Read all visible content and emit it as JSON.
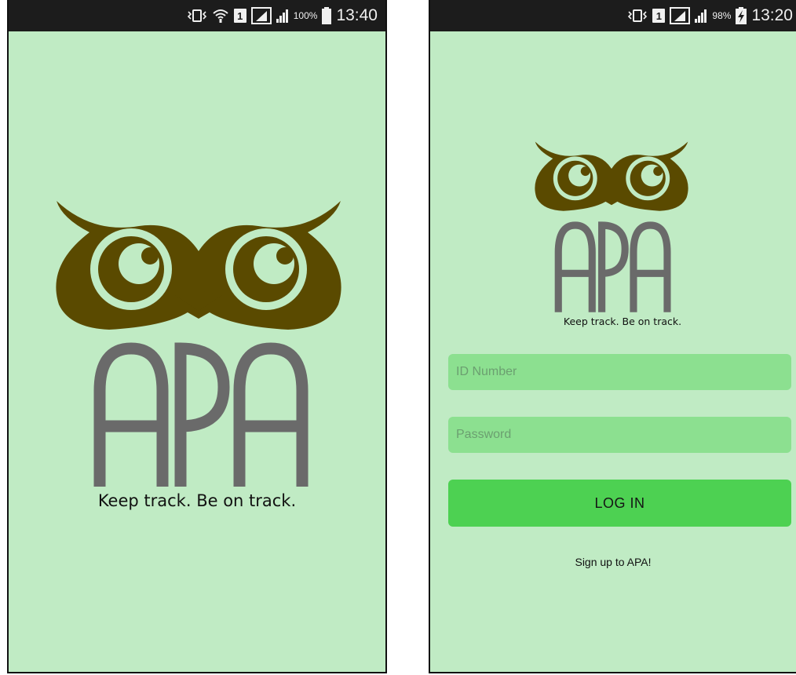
{
  "colors": {
    "screen_bg": "#c0ebc4",
    "status_bar_bg": "#1c1c1c",
    "owl_brown": "#5a4a00",
    "apa_gray": "#6a6a6a",
    "field_bg": "#8ce090",
    "button_bg": "#4dd152"
  },
  "splash": {
    "status": {
      "battery_pct": "100%",
      "time": "13:40"
    },
    "logo_text": "APA",
    "tagline": "Keep track. Be on track."
  },
  "login": {
    "status": {
      "battery_pct": "98%",
      "time": "13:20"
    },
    "logo_text": "APA",
    "tagline": "Keep track. Be on track.",
    "id_placeholder": "ID Number",
    "password_placeholder": "Password",
    "login_label": "LOG IN",
    "signup_label": "Sign up to APA!"
  }
}
